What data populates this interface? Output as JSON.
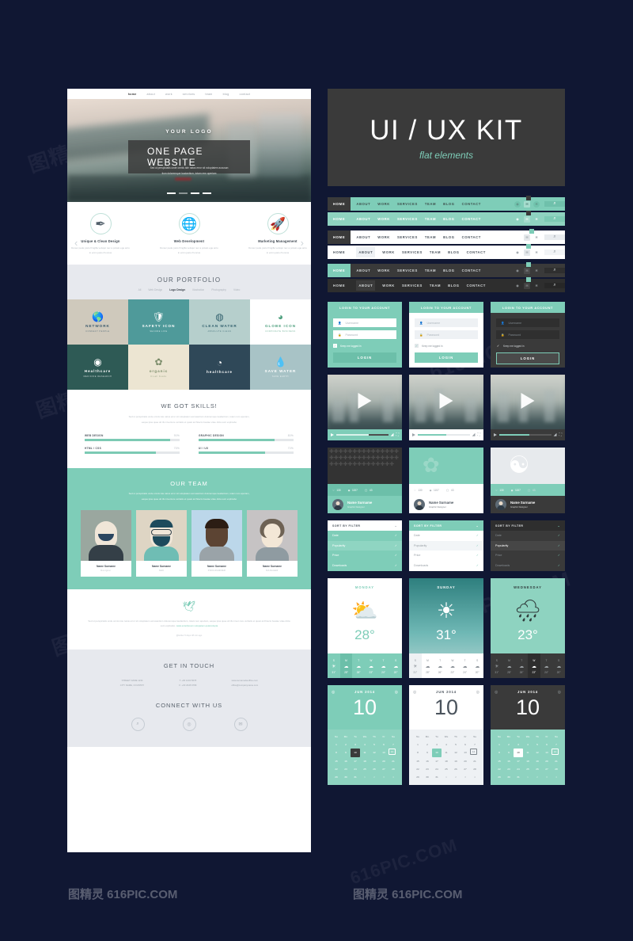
{
  "kit": {
    "title": "UI / UX KIT",
    "subtitle": "flat elements"
  },
  "watermarks": {
    "a": "图精灵 616PIC.COM",
    "b": "616PIC.COM",
    "c": "图精灵 616PIC.COM"
  },
  "site": {
    "nav": [
      "home",
      "about",
      "work",
      "services",
      "team",
      "blog",
      "contact"
    ],
    "logo": "YOUR LOGO",
    "banner": "ONE PAGE WEBSITE",
    "hero_sub_1": "Sed ut perspiciatis unde omnis iste natus error sit voluptatem accusan",
    "hero_sub_2": "tium doloremque laudantium, totam rem aperiam",
    "services": [
      {
        "title": "Unique & Clean Design",
        "text": "Donec pede justo fringilla velsqui nec a potato ege arcu in enim justo rhoncus",
        "icon": "pen-icon"
      },
      {
        "title": "Web Development",
        "text": "Donec pede justo fringilla velsqui nec a potato ege arcu in enim justo rhoncus",
        "icon": "globe-icon"
      },
      {
        "title": "Marketing Management",
        "text": "Donec pede justo fringilla velsqui nec a potato ege arcu in enim justo rhoncus",
        "icon": "rocket-icon"
      }
    ],
    "portfolio_title": "OUR PORTFOLIO",
    "portfolio_filter": [
      "All",
      "Web Design",
      "Logo Design",
      "Illustration",
      "Photography",
      "Video"
    ],
    "portfolio_filter_active": "Logo Design",
    "portfolio_items": [
      {
        "label": "NETWORK",
        "sub": "CONNECT PEOPLE",
        "bg": "#cfc9bc",
        "fg": "#3d5a6c"
      },
      {
        "label": "SAFETY ICON",
        "sub": "SECURE LIFE",
        "bg": "#4f9a9a",
        "fg": "#ffffff"
      },
      {
        "label": "CLEAN WATER",
        "sub": "ABSOLUTE CLEAN",
        "bg": "#b6cfcc",
        "fg": "#33616e"
      },
      {
        "label": "GLOBE ICON",
        "sub": "CORPORATE BUSINESS",
        "bg": "#ffffff",
        "fg": "#4fa07f"
      },
      {
        "label": "Healthcare",
        "sub": "MEDICINE RESEARCH",
        "bg": "#2e5a55",
        "fg": "#ffffff"
      },
      {
        "label": "organic",
        "sub": "Fresh Foods",
        "bg": "#ece5d2",
        "fg": "#7b8c6a"
      },
      {
        "label": "healthcare",
        "sub": "",
        "bg": "#2f4858",
        "fg": "#ffffff"
      },
      {
        "label": "SAVE WATER",
        "sub": "SAVE EARTH",
        "bg": "#a8c3c6",
        "fg": "#ffffff"
      }
    ],
    "skills_title": "WE GOT SKILLS!",
    "skills_lead_1": "Sed ut perspiciatis unde omnis iste natus error sit voluptatem accusantium doloremque laudantium, totam rem aperiam,",
    "skills_lead_2": "eaque ipsa quae ab illo inventore veritatis et quasi architecto beatae vitae dicta sunt explicabo",
    "skills": [
      {
        "name": "WEB DESIGN",
        "pct": "90%",
        "value": 90
      },
      {
        "name": "GRAPHIC DESIGN",
        "pct": "80%",
        "value": 80
      },
      {
        "name": "HTML / CSS",
        "pct": "75%",
        "value": 75
      },
      {
        "name": "UI / UX",
        "pct": "70%",
        "value": 70
      }
    ],
    "team_title": "OUR TEAM",
    "team_lead_1": "Sed ut perspiciatis unde omnis iste natus error sit voluptatem accusantium doloremque laudantium, totam rem aperiam,",
    "team_lead_2": "eaque ipsa quae ab illo inventore veritatis et quasi architecto beatae vitae dicta sunt explicabo",
    "team": [
      {
        "name": "Name Surname",
        "role": "Designer"
      },
      {
        "name": "Name Surname",
        "role": "SEO"
      },
      {
        "name": "Name Surname",
        "role": "PROGRAMMER"
      },
      {
        "name": "Name Surname",
        "role": "MANAGER"
      }
    ],
    "tweet_text": "Sed ut perspiciatis unde omnis iste natus error sit voluptatem accusantium doloremque laudantium, totam rem aperiam, eaque ipsa quae ab illo inven tore veritatis et quasi architecto beatae vitae dicta sunt explicabo.",
    "tweet_link": "www.enterlipsum.volupatem.quia/volupta",
    "tweet_ago": "@twitter 5 days 48 min ago",
    "contact_title": "GET IN TOUCH",
    "contact_cols": [
      {
        "l1": "STREET NAME 1234",
        "l2": "CITY NAME, COUNTRY"
      },
      {
        "l1": "T: +00 1234 5678",
        "l2": "F: +00 2345 6789"
      },
      {
        "l1": "www.surnamebeoffice.com",
        "l2": "office@companyname.com"
      }
    ],
    "connect_title": "CONNECT WITH US",
    "social_icons": [
      "search-icon",
      "camera-icon",
      "mail-icon"
    ]
  },
  "navbars": {
    "items": [
      "HOME",
      "ABOUT",
      "WORK",
      "SERVICES",
      "TEAM",
      "BLOG",
      "CONTACT"
    ],
    "icons": [
      "globe-icon",
      "mail-icon",
      "gear-icon"
    ],
    "search_icon": "search-icon",
    "variants": [
      {
        "style": "teal-dark-home",
        "bg": "#7ecdb8",
        "home_bg": "#3a3a3a",
        "home_fg": "#ffffff",
        "text": "#3f4f4c",
        "search_bg": "#6fc0ab"
      },
      {
        "style": "teal-light",
        "bg": "#8ed3c0",
        "home_bg": "#8ed3c0",
        "home_fg": "#ffffff",
        "text": "#ffffff",
        "search_bg": "#7ccab4"
      },
      {
        "style": "white-dark-home",
        "bg": "#ffffff",
        "home_bg": "#3a3a3a",
        "home_fg": "#ffffff",
        "text": "#4a535c",
        "search_bg": "#e9ecef"
      },
      {
        "style": "white",
        "bg": "#ffffff",
        "home_bg": "#ffffff",
        "home_fg": "#4a535c",
        "text": "#4a535c",
        "search_bg": "#f2f4f6"
      },
      {
        "style": "dark-teal-home",
        "bg": "#3a3a3a",
        "home_bg": "#7ecdb8",
        "home_fg": "#ffffff",
        "text": "#d8dcdd",
        "search_bg": "#2f2f2f"
      },
      {
        "style": "dark",
        "bg": "#2e2e2e",
        "home_bg": "#2e2e2e",
        "home_fg": "#d8dcdd",
        "text": "#d8dcdd",
        "search_bg": "#272727"
      }
    ]
  },
  "login": {
    "title": "LOGIN TO YOUR ACCOUNT",
    "username_placeholder": "Username",
    "password_placeholder": "Password",
    "remember_label": "Keep me logged in",
    "button": "LOGIN",
    "user_icon": "user-icon",
    "lock_icon": "lock-icon",
    "check_icon": "check-icon"
  },
  "video": {
    "play_icon": "play-icon",
    "volume_icon": "volume-icon",
    "fullscreen_icon": "fullscreen-icon",
    "progress": [
      62,
      55,
      58
    ]
  },
  "profile_card": {
    "likes": "130",
    "views": "1157",
    "comments": "43",
    "name": "Name Surname",
    "role": "Graphic Designer",
    "heart_icon": "heart-icon",
    "eye_icon": "eye-icon",
    "comment-icon": "comment-icon",
    "avatar": "avatar"
  },
  "sort_filter": {
    "title": "SORT BY FILTER",
    "chevron_icon": "chevron-down-icon",
    "check_icon": "check-icon",
    "options": [
      "Date",
      "Popularity",
      "Price",
      "Downloads"
    ],
    "active": "Popularity"
  },
  "weather": [
    {
      "day": "MONDAY",
      "temp": "28°",
      "icon": "sun-cloud-icon",
      "style": "light"
    },
    {
      "day": "SUNDAY",
      "temp": "31°",
      "icon": "sun-icon",
      "style": "photo"
    },
    {
      "day": "WEDNESDAY",
      "temp": "23°",
      "icon": "rain-cloud-icon",
      "style": "teal"
    }
  ],
  "weather_forecast": {
    "days": [
      "S",
      "M",
      "T",
      "W",
      "T",
      "S"
    ],
    "temps": [
      "31°",
      "28°",
      "26°",
      "23°",
      "24°",
      "20°"
    ],
    "icons": [
      "sun-icon",
      "cloud-icon",
      "cloud-icon",
      "cloud-icon",
      "cloud-icon",
      "cloud-icon"
    ],
    "active_index": [
      1,
      0,
      3
    ]
  },
  "calendar": {
    "month": "JUN 2014",
    "big_day": "10",
    "prev_icon": "prev-icon",
    "next_icon": "next-icon",
    "weekdays": [
      "Su",
      "Mo",
      "Tu",
      "We",
      "Th",
      "Fr",
      "Sa"
    ],
    "weeks": [
      [
        "1",
        "2",
        "3",
        "4",
        "5",
        "6",
        "7"
      ],
      [
        "8",
        "9",
        "10",
        "11",
        "12",
        "13",
        "14"
      ],
      [
        "15",
        "16",
        "17",
        "18",
        "19",
        "20",
        "21"
      ],
      [
        "22",
        "23",
        "24",
        "25",
        "26",
        "27",
        "28"
      ],
      [
        "29",
        "30",
        "31",
        "1",
        "2",
        "3",
        "4"
      ]
    ],
    "selected": "10",
    "outlined": "14"
  },
  "colors": {
    "bg": "#101733",
    "accent": "#7ecdb8",
    "dark": "#3a3a3a",
    "light": "#ffffff",
    "muted": "#e7e9ee"
  }
}
